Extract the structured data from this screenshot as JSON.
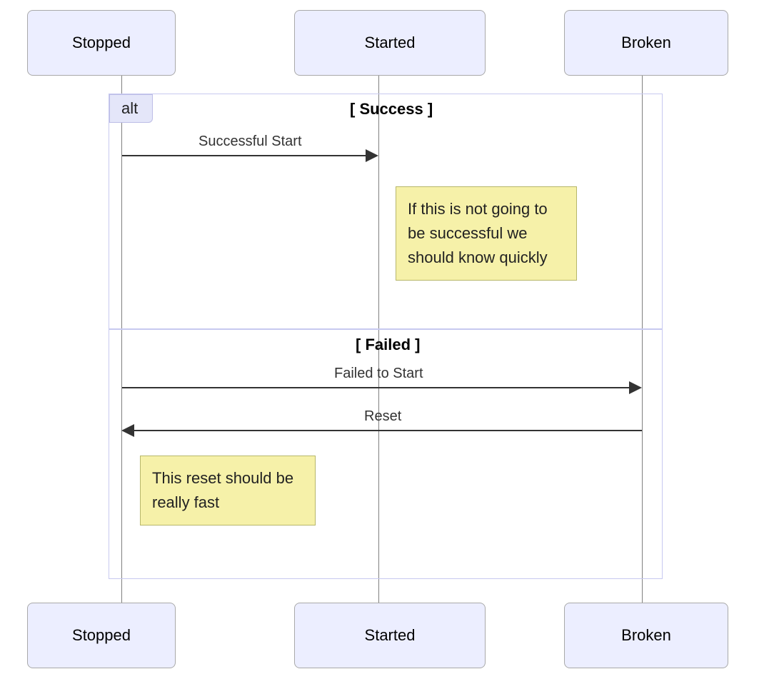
{
  "participants": {
    "stopped": "Stopped",
    "started": "Started",
    "broken": "Broken"
  },
  "alt": {
    "label": "alt",
    "sections": {
      "success": "[ Success ]",
      "failed": "[ Failed ]"
    }
  },
  "messages": {
    "successful_start": "Successful Start",
    "failed_to_start": "Failed to Start",
    "reset": "Reset"
  },
  "notes": {
    "note_success": "If this is not going to be successful we should know quickly",
    "note_reset": "This reset should be really fast"
  },
  "layout": {
    "colors": {
      "participant_fill": "#eceeff",
      "participant_border": "#a9a9a9",
      "frame_border": "#c7c9f0",
      "note_fill": "#f6f1a9",
      "note_border": "#b7b76a",
      "arrow": "#333333"
    },
    "lifeline_x": {
      "stopped": 170,
      "started": 530,
      "broken": 899
    }
  }
}
